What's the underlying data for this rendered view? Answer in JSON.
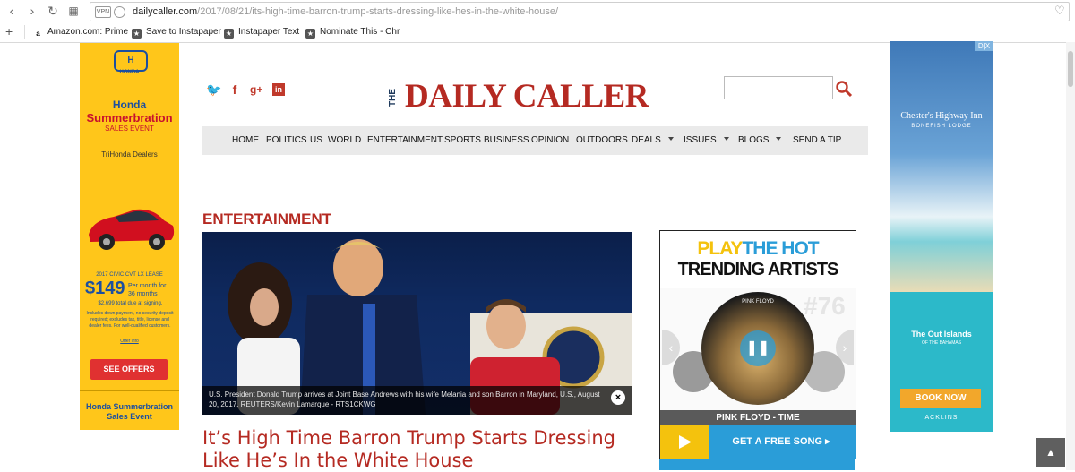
{
  "browser": {
    "url_host": "dailycaller.com",
    "url_path": "/2017/08/21/its-high-time-barron-trump-starts-dressing-like-hes-in-the-white-house/",
    "vpn_badge": "VPN",
    "bookmarks": [
      "Amazon.com: Prime",
      "Save to Instapaper",
      "Instapaper Text",
      "Nominate This - Chr"
    ]
  },
  "left_ad": {
    "brand": "HONDA",
    "headline_1": "Honda",
    "headline_2": "Summerbration",
    "headline_3": "SALES EVENT",
    "dealer": "TriHonda Dealers",
    "model": "2017 CIVIC CVT LX LEASE",
    "price": "$149",
    "price_terms_1": "Per month for",
    "price_terms_2": "36 months",
    "due": "$2,699 total due at signing.",
    "fine_print": "Includes down payment, no security deposit required; excludes tax, title, license and dealer fees. For well-qualified customers.",
    "offer_info": "Offer info",
    "cta": "SEE OFFERS",
    "footer": "Honda Summerbration Sales Event"
  },
  "right_ad": {
    "top_name": "Chester's Highway Inn",
    "top_sub": "BONEFISH LODGE",
    "brand_1": "The Out Islands",
    "brand_2": "OF THE BAHAMAS",
    "cta": "BOOK NOW",
    "footer": "ACKLINS",
    "adchoices": "D|X"
  },
  "site": {
    "logo_the": "THE",
    "logo_name": "DAILY CALLER",
    "social": [
      "twitter-icon",
      "facebook-icon",
      "google-plus-icon",
      "linkedin-icon"
    ],
    "menu": [
      "HOME",
      "POLITICS",
      "US",
      "WORLD",
      "ENTERTAINMENT",
      "SPORTS",
      "BUSINESS",
      "OPINION",
      "OUTDOORS",
      "DEALS",
      "ISSUES",
      "BLOGS",
      "SEND A TIP"
    ]
  },
  "article": {
    "section": "ENTERTAINMENT",
    "caption": "U.S. President Donald Trump arrives at Joint Base Andrews with his wife Melania and son Barron in Maryland, U.S., August 20, 2017. REUTERS/Kevin Lamarque - RTS1CKWG",
    "caption_close": "×",
    "headline": "It’s High Time Barron Trump Starts Dressing Like He’s In the White House"
  },
  "widget": {
    "line1_a": "PLAY",
    "line1_b": "THE HOT",
    "line2": "TRENDING ARTISTS",
    "album_label": "PINK FLOYD",
    "album_number": "#76",
    "track": "PINK FLOYD - TIME",
    "cta": "GET A FREE SONG ▸"
  },
  "colors": {
    "brand_red": "#b52a22",
    "menu_bg": "#eaeaea",
    "honda_yellow": "#ffc61a",
    "widget_blue": "#2a9dd8",
    "widget_yellow": "#f4c20d"
  }
}
